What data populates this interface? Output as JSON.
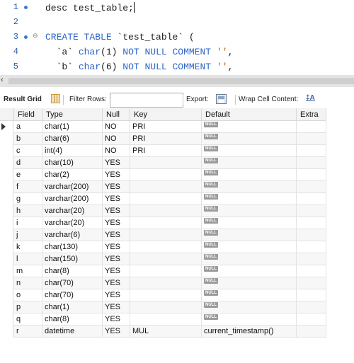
{
  "editor": {
    "lines": [
      {
        "num": "1",
        "has_dot": true
      },
      {
        "num": "2",
        "has_dot": false
      },
      {
        "num": "3",
        "has_dot": true
      },
      {
        "num": "4",
        "has_dot": false
      },
      {
        "num": "5",
        "has_dot": false
      }
    ],
    "line1": {
      "t1": "desc test_table;"
    },
    "line3": {
      "k1": "CREATE",
      "k2": "TABLE",
      "t1": "`test_table`",
      "t2": "("
    },
    "line4": {
      "t1": "`a`",
      "k1": "char",
      "t2": "(1)",
      "k2": "NOT NULL COMMENT",
      "s1": "''",
      "t3": ","
    },
    "line5": {
      "t1": "`b`",
      "k1": "char",
      "t2": "(6)",
      "k2": "NOT NULL COMMENT",
      "s1": "''",
      "t3": ","
    }
  },
  "scrollbar": {
    "left_arrow": "‹"
  },
  "toolbar": {
    "result_grid": "Result Grid",
    "filter_rows": "Filter Rows:",
    "filter_value": "",
    "export": "Export:",
    "wrap": "Wrap Cell Content:"
  },
  "grid": {
    "columns": [
      "Field",
      "Type",
      "Null",
      "Key",
      "Default",
      "Extra"
    ],
    "null_badge": "NULL",
    "rows": [
      {
        "field": "a",
        "type": "char(1)",
        "null": "NO",
        "key": "PRI",
        "default": "NULL",
        "extra": ""
      },
      {
        "field": "b",
        "type": "char(6)",
        "null": "NO",
        "key": "PRI",
        "default": "NULL",
        "extra": ""
      },
      {
        "field": "c",
        "type": "int(4)",
        "null": "NO",
        "key": "PRI",
        "default": "NULL",
        "extra": ""
      },
      {
        "field": "d",
        "type": "char(10)",
        "null": "YES",
        "key": "",
        "default": "NULL",
        "extra": ""
      },
      {
        "field": "e",
        "type": "char(2)",
        "null": "YES",
        "key": "",
        "default": "NULL",
        "extra": ""
      },
      {
        "field": "f",
        "type": "varchar(200)",
        "null": "YES",
        "key": "",
        "default": "NULL",
        "extra": ""
      },
      {
        "field": "g",
        "type": "varchar(200)",
        "null": "YES",
        "key": "",
        "default": "NULL",
        "extra": ""
      },
      {
        "field": "h",
        "type": "varchar(20)",
        "null": "YES",
        "key": "",
        "default": "NULL",
        "extra": ""
      },
      {
        "field": "i",
        "type": "varchar(20)",
        "null": "YES",
        "key": "",
        "default": "NULL",
        "extra": ""
      },
      {
        "field": "j",
        "type": "varchar(6)",
        "null": "YES",
        "key": "",
        "default": "NULL",
        "extra": ""
      },
      {
        "field": "k",
        "type": "char(130)",
        "null": "YES",
        "key": "",
        "default": "NULL",
        "extra": ""
      },
      {
        "field": "l",
        "type": "char(150)",
        "null": "YES",
        "key": "",
        "default": "NULL",
        "extra": ""
      },
      {
        "field": "m",
        "type": "char(8)",
        "null": "YES",
        "key": "",
        "default": "NULL",
        "extra": ""
      },
      {
        "field": "n",
        "type": "char(70)",
        "null": "YES",
        "key": "",
        "default": "NULL",
        "extra": ""
      },
      {
        "field": "o",
        "type": "char(70)",
        "null": "YES",
        "key": "",
        "default": "NULL",
        "extra": ""
      },
      {
        "field": "p",
        "type": "char(1)",
        "null": "YES",
        "key": "",
        "default": "NULL",
        "extra": ""
      },
      {
        "field": "q",
        "type": "char(8)",
        "null": "YES",
        "key": "",
        "default": "NULL",
        "extra": ""
      },
      {
        "field": "r",
        "type": "datetime",
        "null": "YES",
        "key": "MUL",
        "default": "current_timestamp()",
        "extra": ""
      }
    ]
  }
}
